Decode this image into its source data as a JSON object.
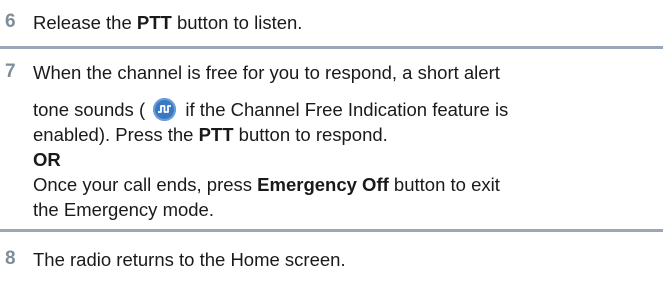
{
  "steps": [
    {
      "number": "6",
      "before": "Release the ",
      "bold": "PTT",
      "after": " button to listen."
    },
    {
      "number": "7",
      "line1": "When the channel is free for you to respond, a short alert",
      "line2_before": "tone sounds ( ",
      "line2_after": " if the Channel Free Indication feature is",
      "line3_before": "enabled). Press the ",
      "line3_bold": "PTT",
      "line3_after": " button to respond.",
      "or_label": "OR",
      "line5_before": "Once your call ends, press ",
      "line5_bold": "Emergency Off",
      "line5_after": " button to exit",
      "line6": "the Emergency mode."
    },
    {
      "number": "8",
      "text": "The radio returns to the Home screen."
    }
  ],
  "icons": {
    "alert_tone": "channel-free-tone-icon"
  },
  "colors": {
    "step_number": "#7f8d99",
    "rule": "#99a8b6",
    "icon_fill": "#3b78c2"
  }
}
